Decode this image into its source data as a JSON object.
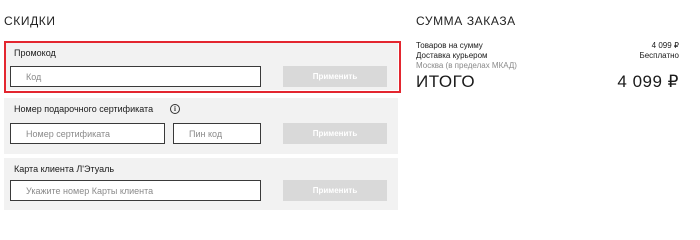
{
  "discounts": {
    "title": "СКИДКИ",
    "promo": {
      "label": "Промокод",
      "placeholder": "Код",
      "apply_label": "Применить"
    },
    "certificate": {
      "label": "Номер подарочного сертификата",
      "number_placeholder": "Номер сертификата",
      "pin_placeholder": "Пин код",
      "apply_label": "Применить",
      "info_icon": "i"
    },
    "client_card": {
      "label": "Карта клиента Л'Этуаль",
      "placeholder": "Укажите номер Карты клиента",
      "apply_label": "Применить"
    }
  },
  "summary": {
    "title": "СУММА ЗАКАЗА",
    "items_label": "Товаров на сумму",
    "items_value": "4 099 ₽",
    "delivery_label": "Доставка курьером",
    "delivery_value": "Бесплатно",
    "region": "Москва (в пределах МКАД)",
    "total_label": "ИТОГО",
    "total_value": "4 099 ₽"
  },
  "colors": {
    "highlight": "#e3262f",
    "panel_bg": "#f2f2f2",
    "button_bg": "#d9d9d9"
  },
  "icons": [
    "info-icon"
  ]
}
